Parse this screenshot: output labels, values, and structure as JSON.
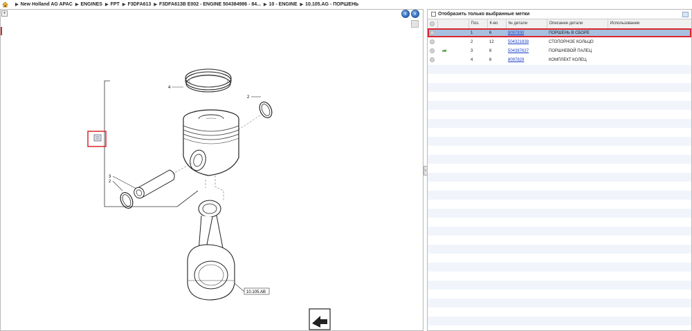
{
  "breadcrumb": {
    "items": [
      "New Holland AG APAC",
      "ENGINES",
      "FPT",
      "F3DFA613",
      "F3DFA613B E002 - ENGINE 504384986 - 84...",
      "10 - ENGINE",
      "10.105.AG - ПОРШЕНЬ"
    ]
  },
  "filter": {
    "label": "Отобразить только выбранные метки"
  },
  "table": {
    "headers": [
      "",
      "",
      "Поз.",
      "К-во",
      "№ детали",
      "Описание детали",
      "Использование"
    ],
    "rows": [
      {
        "pos": "1",
        "qty": "6",
        "part": "8097830",
        "desc": "ПОРШЕНЬ В СБОРЕ",
        "usage": ""
      },
      {
        "pos": "2",
        "qty": "12",
        "part": "504321838",
        "desc": "СТОПОРНОЕ КОЛЬЦО",
        "usage": ""
      },
      {
        "pos": "3",
        "qty": "6",
        "part": "504387637",
        "desc": "ПОРШНЕВОЙ ПАЛЕЦ",
        "usage": ""
      },
      {
        "pos": "4",
        "qty": "6",
        "part": "8097829",
        "desc": "КОМПЛЕКТ КОЛЕЦ",
        "usage": ""
      }
    ]
  },
  "diagram": {
    "callouts": [
      "4",
      "2",
      "3",
      "2"
    ],
    "reference_label": "10.105.AB"
  },
  "colors": {
    "selection": "#a7c0df",
    "highlight_border": "#d9262c",
    "link": "#1a3fc8",
    "nav_button": "#2e66b4"
  }
}
